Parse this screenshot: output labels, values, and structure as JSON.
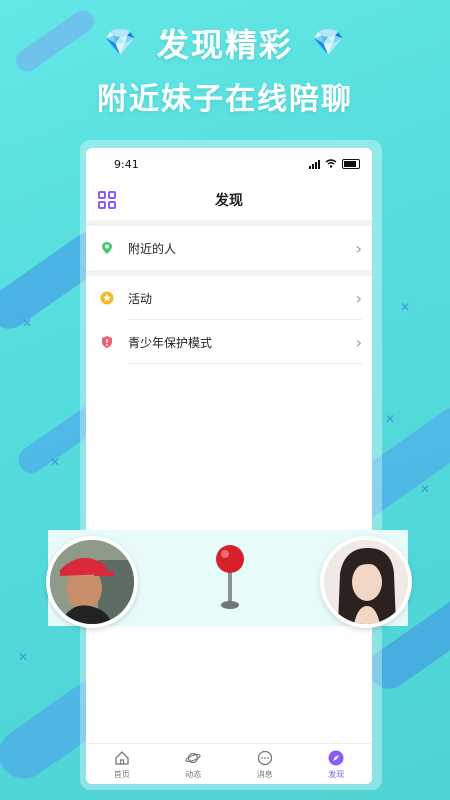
{
  "headline": {
    "line1": "发现精彩",
    "line2": "附近妹子在线陪聊"
  },
  "status_bar": {
    "time": "9:41"
  },
  "nav": {
    "title": "发现"
  },
  "menu": [
    {
      "label": "附近的人",
      "icon": "location-pin-icon",
      "color": "#4cc96b"
    },
    {
      "label": "活动",
      "icon": "star-badge-icon",
      "color": "#f6b62a"
    },
    {
      "label": "青少年保护模式",
      "icon": "shield-icon",
      "color": "#f06070"
    }
  ],
  "tabs": [
    {
      "label": "首页",
      "icon": "home-icon"
    },
    {
      "label": "动态",
      "icon": "planet-icon"
    },
    {
      "label": "消息",
      "icon": "chat-icon"
    },
    {
      "label": "发现",
      "icon": "compass-icon",
      "active": true
    }
  ],
  "colors": {
    "accent": "#8b5cf6",
    "background": "#5de0e0"
  }
}
